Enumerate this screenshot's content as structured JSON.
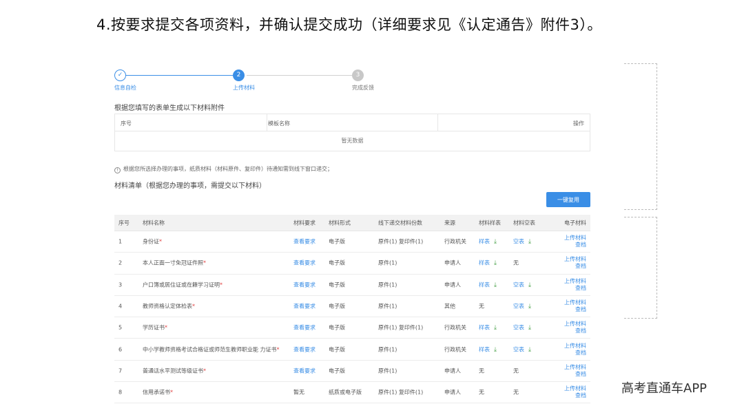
{
  "heading": "4.按要求提交各项资料，并确认提交成功（详细要求见《认定通告》附件3）。",
  "steps": [
    {
      "num": "✓",
      "label": "信息自检",
      "state": "done"
    },
    {
      "num": "2",
      "label": "上传材料",
      "state": "active"
    },
    {
      "num": "3",
      "label": "完成反馈",
      "state": "todo"
    }
  ],
  "section1": {
    "title": "根据您填写的表单生成以下材料附件",
    "headers": [
      "序号",
      "模板名称",
      "操作"
    ],
    "empty_text": "暂无数据"
  },
  "note": "根据您所选择办理的事项，纸质材料（材料原件、复印件）待通知需到线下窗口递交；",
  "section2_title": "材料清单（根据您办理的事项，需提交以下材料）",
  "reuse_button": "一键复用",
  "table_headers": [
    "序号",
    "材料名称",
    "材料要求",
    "材料形式",
    "线下递交材料份数",
    "来源",
    "材料样表",
    "材料空表",
    "电子材料"
  ],
  "rows": [
    {
      "no": "1",
      "name": "身份证",
      "req": "查看要求",
      "form": "电子版",
      "copies": "原件(1) 复印件(1)",
      "source": "行政机关",
      "sample": "样表",
      "blank": "空表",
      "upload": "上传材料",
      "view": "查档"
    },
    {
      "no": "2",
      "name": "本人正面一寸免冠证件照",
      "req": "查看要求",
      "form": "电子版",
      "copies": "原件(1)",
      "source": "申请人",
      "sample": "样表",
      "blank": "无",
      "upload": "上传材料",
      "view": "查档"
    },
    {
      "no": "3",
      "name": "户口簿或居住证或在籍学习证明",
      "req": "查看要求",
      "form": "电子版",
      "copies": "原件(1)",
      "source": "申请人",
      "sample": "样表",
      "blank": "空表",
      "upload": "上传材料",
      "view": "查档"
    },
    {
      "no": "4",
      "name": "教师资格认定体检表",
      "req": "查看要求",
      "form": "电子版",
      "copies": "原件(1)",
      "source": "其他",
      "sample": "无",
      "blank": "空表",
      "upload": "上传材料",
      "view": "查档"
    },
    {
      "no": "5",
      "name": "学历证书",
      "req": "查看要求",
      "form": "电子版",
      "copies": "原件(1) 复印件(1)",
      "source": "行政机关",
      "sample": "样表",
      "blank": "空表",
      "upload": "上传材料",
      "view": "查档"
    },
    {
      "no": "6",
      "name": "中小学教师资格考试合格证或师范生教师职业能 力证书",
      "req": "查看要求",
      "form": "电子版",
      "copies": "原件(1)",
      "source": "行政机关",
      "sample": "样表",
      "blank": "空表",
      "upload": "上传材料",
      "view": "查档"
    },
    {
      "no": "7",
      "name": "普通话水平测试等级证书",
      "req": "查看要求",
      "form": "电子版",
      "copies": "原件(1)",
      "source": "申请人",
      "sample": "无",
      "blank": "无",
      "upload": "上传材料",
      "view": "查档"
    },
    {
      "no": "8",
      "name": "信用承诺书",
      "req": "暂无",
      "form": "纸质或电子版",
      "copies": "原件(1) 复印件(1)",
      "source": "申请人",
      "sample": "无",
      "blank": "无",
      "upload": "上传材料",
      "view": "查档"
    }
  ],
  "required_mark": "*",
  "watermark": "高考直通车APP",
  "colors": {
    "accent": "#3a8ee6",
    "required": "#e04040",
    "download": "#4aa14a"
  }
}
